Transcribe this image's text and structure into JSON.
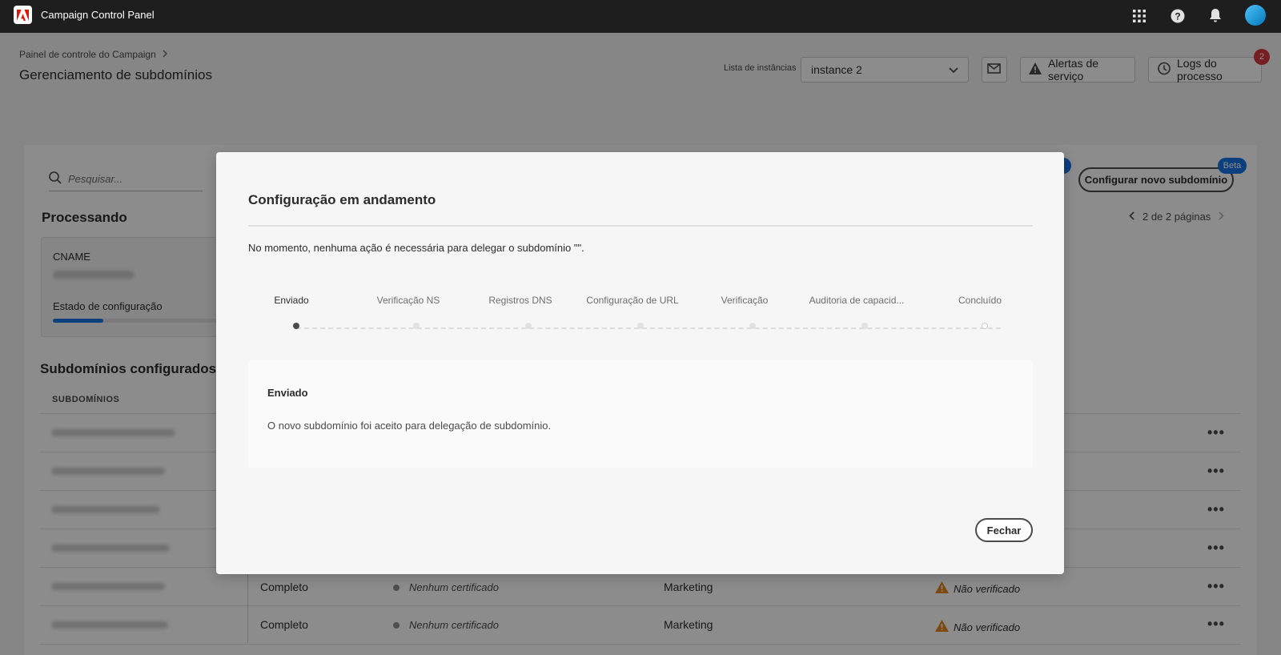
{
  "app": {
    "title": "Campaign Control Panel"
  },
  "header": {
    "breadcrumb": "Painel de controle do Campaign",
    "page_title": "Gerenciamento de subdomínios",
    "instance_label": "Lista de instâncias",
    "instance_value": "instance 2",
    "service_alerts": "Alertas de serviço",
    "process_logs": "Logs do processo",
    "logs_badge": "2"
  },
  "main": {
    "search_placeholder": "Pesquisar...",
    "processing_title": "Processando",
    "cname_label": "CNAME",
    "config_state_label": "Estado de configuração",
    "config_progress": 0.3,
    "configured_title": "Subdomínios configurados",
    "col_subdomains": "SUBDOMÍNIOS",
    "pager": "2 de 2 páginas",
    "config_button": "Configurar novo subdomínio",
    "beta": "Beta",
    "rows": [
      {
        "status": "Completo",
        "cert": "Nenhum certificado",
        "type": "Marketing",
        "verify": "Não verificado"
      },
      {
        "status": "Completo",
        "cert": "Nenhum certificado",
        "type": "Marketing",
        "verify": "Não verificado"
      }
    ]
  },
  "modal": {
    "title": "Configuração em andamento",
    "message": "No momento, nenhuma ação é necessária para delegar o subdomínio \"\".",
    "steps": [
      "Enviado",
      "Verificação NS",
      "Registros DNS",
      "Configuração de URL",
      "Verificação",
      "Auditoria de capacid...",
      "Concluído"
    ],
    "detail_title": "Enviado",
    "detail_text": "O novo subdomínio foi aceito para delegação de subdomínio.",
    "close": "Fechar"
  },
  "colors": {
    "accent": "#1473e6",
    "badge": "#d7373f",
    "warning": "#e68619",
    "topbar": "#1e1e1e"
  },
  "icons": [
    "adobe-logo-icon",
    "apps-grid-icon",
    "help-icon",
    "bell-icon",
    "chevron-right-icon",
    "chevron-down-icon",
    "mail-icon",
    "alert-icon",
    "history-icon",
    "search-icon",
    "chevron-left-icon",
    "more-icon",
    "warning-icon"
  ]
}
